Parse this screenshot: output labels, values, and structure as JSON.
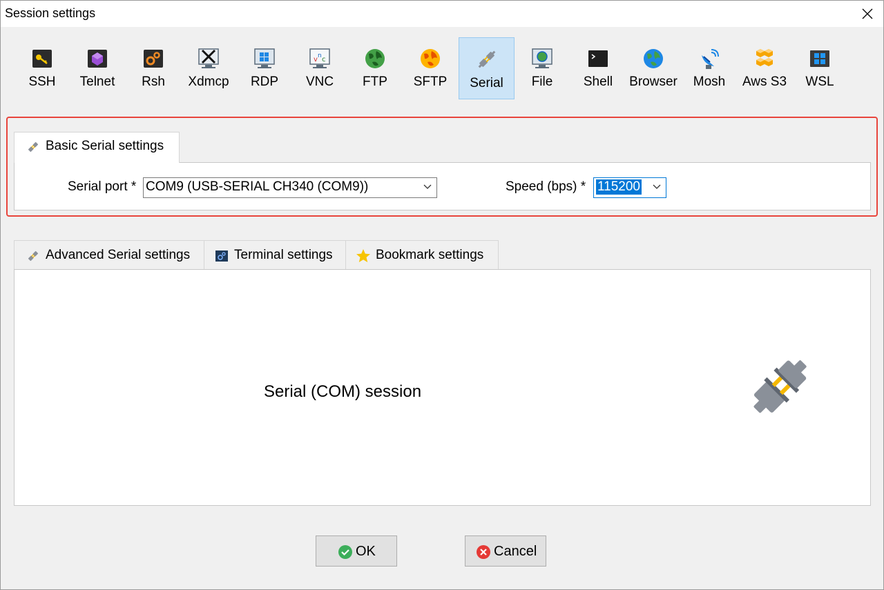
{
  "window": {
    "title": "Session settings"
  },
  "toolbar": {
    "items": [
      {
        "label": "SSH",
        "icon": "ssh-key-icon"
      },
      {
        "label": "Telnet",
        "icon": "telnet-icon"
      },
      {
        "label": "Rsh",
        "icon": "rsh-icon"
      },
      {
        "label": "Xdmcp",
        "icon": "xdmcp-icon"
      },
      {
        "label": "RDP",
        "icon": "rdp-icon"
      },
      {
        "label": "VNC",
        "icon": "vnc-icon"
      },
      {
        "label": "FTP",
        "icon": "ftp-globe-icon"
      },
      {
        "label": "SFTP",
        "icon": "sftp-globe-icon"
      },
      {
        "label": "Serial",
        "icon": "serial-plug-icon",
        "selected": true
      },
      {
        "label": "File",
        "icon": "file-monitor-icon"
      },
      {
        "label": "Shell",
        "icon": "shell-terminal-icon"
      },
      {
        "label": "Browser",
        "icon": "browser-globe-icon"
      },
      {
        "label": "Mosh",
        "icon": "mosh-satellite-icon"
      },
      {
        "label": "Aws S3",
        "icon": "aws-s3-icon"
      },
      {
        "label": "WSL",
        "icon": "wsl-windows-icon"
      }
    ]
  },
  "basic": {
    "tab_label": "Basic Serial settings",
    "serial_port_label": "Serial port *",
    "serial_port_value": "COM9  (USB-SERIAL CH340 (COM9))",
    "speed_label": "Speed (bps) *",
    "speed_value": "115200"
  },
  "lower_tabs": {
    "advanced": "Advanced Serial settings",
    "terminal": "Terminal settings",
    "bookmark": "Bookmark settings"
  },
  "content": {
    "session_text": "Serial (COM) session"
  },
  "buttons": {
    "ok": "OK",
    "cancel": "Cancel"
  },
  "colors": {
    "highlight_box": "#e8453c",
    "selection": "#0078d7",
    "active_tool_bg": "#cce4f7"
  }
}
